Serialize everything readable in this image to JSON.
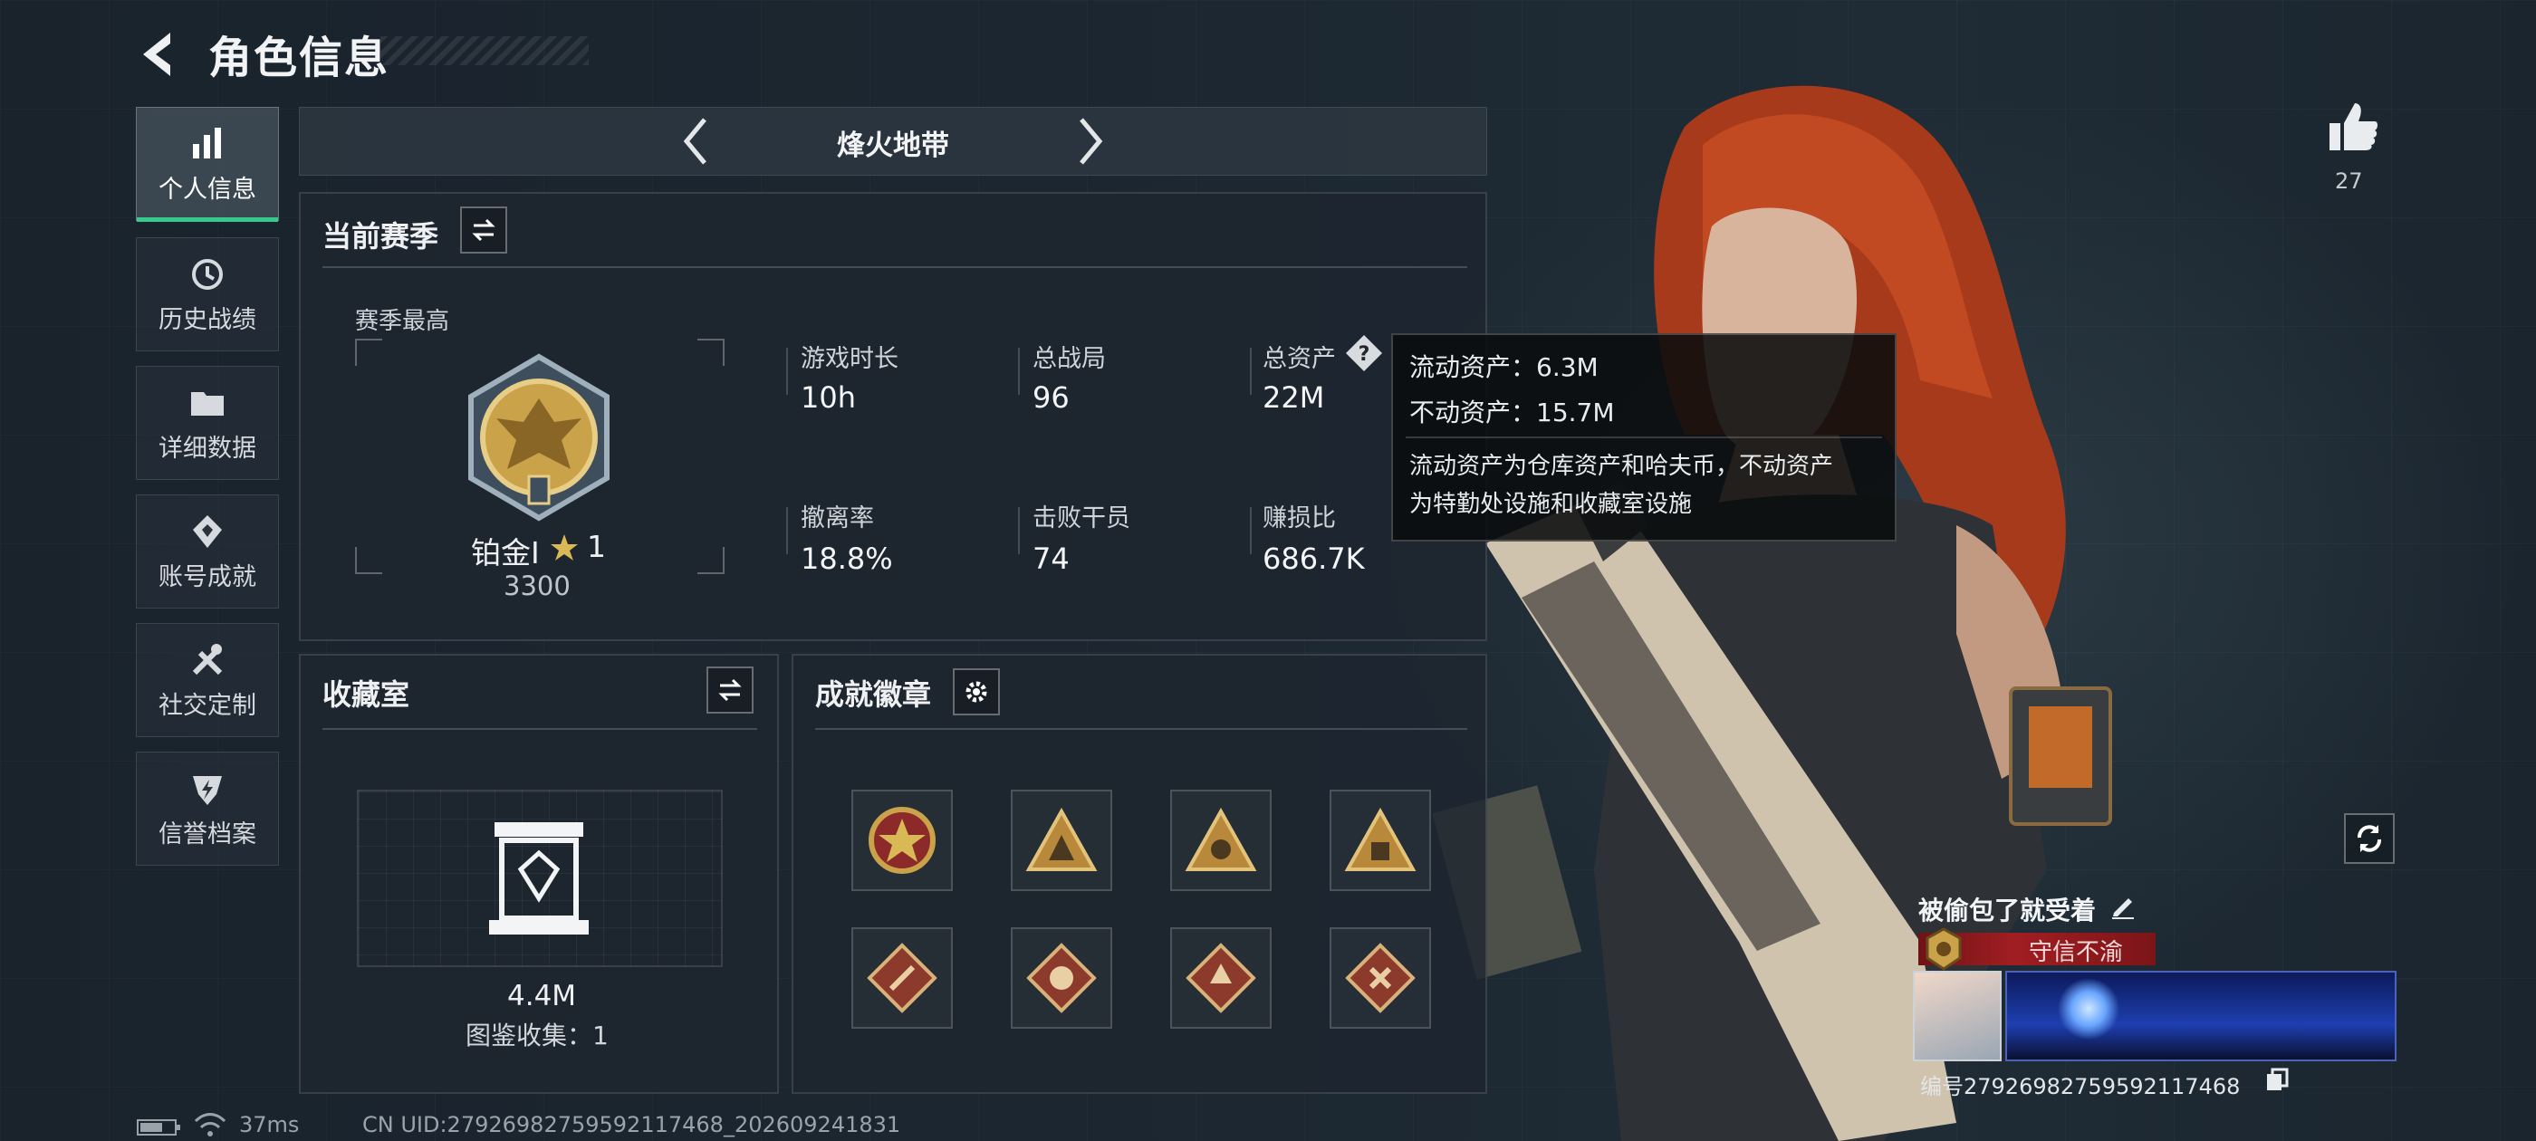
{
  "header": {
    "title": "角色信息"
  },
  "nav": [
    {
      "label": "个人信息",
      "icon": "bar-chart-icon",
      "active": true
    },
    {
      "label": "历史战绩",
      "icon": "history-clock-icon"
    },
    {
      "label": "详细数据",
      "icon": "folder-icon"
    },
    {
      "label": "账号成就",
      "icon": "achievement-icon"
    },
    {
      "label": "社交定制",
      "icon": "tools-icon"
    },
    {
      "label": "信誉档案",
      "icon": "shield-icon"
    }
  ],
  "mode": {
    "name": "烽火地带"
  },
  "season": {
    "title": "当前赛季",
    "best_label": "赛季最高",
    "rank_name": "铂金Ⅰ",
    "rank_stars": "1",
    "rank_score": "3300",
    "stats": [
      {
        "label": "游戏时长",
        "value": "10h"
      },
      {
        "label": "总战局",
        "value": "96"
      },
      {
        "label": "总资产",
        "value": "22M"
      },
      {
        "label": "撤离率",
        "value": "18.8%"
      },
      {
        "label": "击败干员",
        "value": "74"
      },
      {
        "label": "赚损比",
        "value": "686.7K"
      }
    ]
  },
  "tooltip": {
    "liquid": "流动资产：6.3M",
    "fixed": "不动资产：15.7M",
    "desc_line1": "流动资产为仓库资产和哈夫币，不动资产",
    "desc_line2": "为特勤处设施和收藏室设施"
  },
  "collection": {
    "title": "收藏室",
    "value": "4.4M",
    "count": "图鉴收集：1"
  },
  "badges": {
    "title": "成就徽章",
    "items": [
      "round-medal-icon",
      "triangle-badge-icon",
      "triangle-badge-icon",
      "triangle-badge-icon",
      "diamond-badge-icon",
      "diamond-badge-icon",
      "diamond-badge-icon",
      "diamond-badge-icon"
    ]
  },
  "profile": {
    "likes": "27",
    "nickname": "被偷包了就受着",
    "reputation": "守信不渝",
    "id_text": "编号2792698275959211746​8"
  },
  "status_bar": {
    "ping": "37ms",
    "uid": "CN UID:27926982759592117468_202609241831"
  },
  "colors": {
    "accent_green": "#38c98e",
    "reputation_red": "#a01e22",
    "gold": "#c9a24a"
  }
}
